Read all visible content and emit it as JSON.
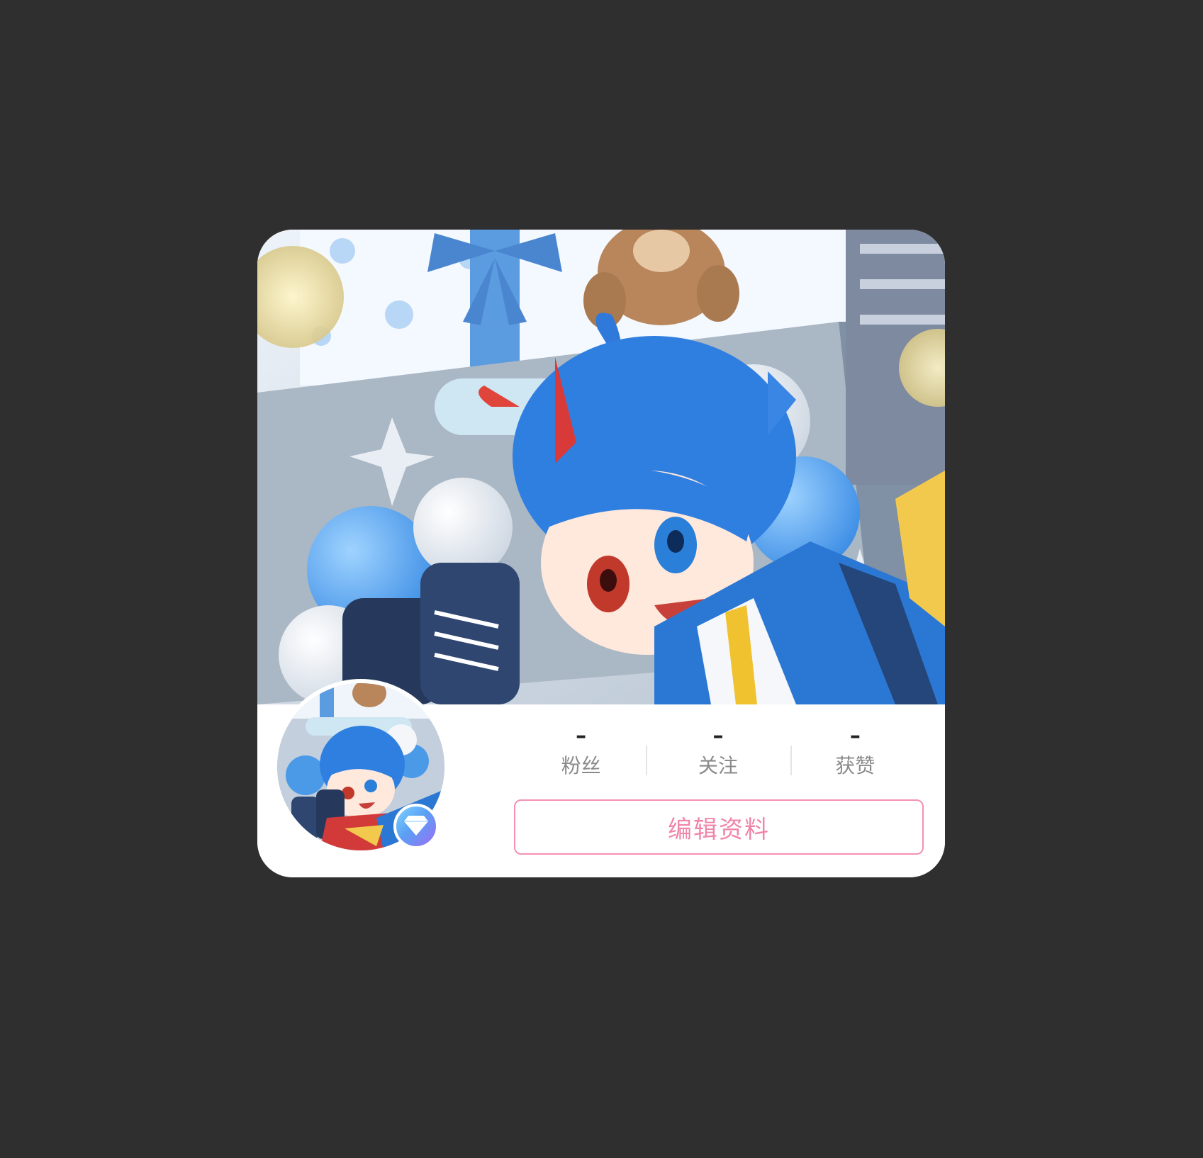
{
  "profile": {
    "stats": [
      {
        "value": "–",
        "label": "粉丝"
      },
      {
        "value": "–",
        "label": "关注"
      },
      {
        "value": "–",
        "label": "获赞"
      }
    ],
    "edit_button_label": "编辑资料"
  },
  "theme": {
    "page_background": "#2f2f2f",
    "card_background": "#ffffff",
    "accent_pink": "#f085aa",
    "label_gray": "#8a8a8a"
  },
  "icons": {
    "badge": "diamond-icon"
  }
}
